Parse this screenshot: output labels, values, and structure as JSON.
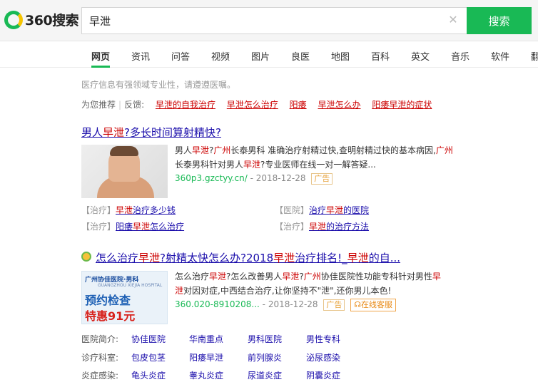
{
  "header": {
    "logo_text": "360搜索",
    "search_value": "早泄",
    "search_button": "搜索"
  },
  "tabs": [
    "网页",
    "资讯",
    "问答",
    "视频",
    "图片",
    "良医",
    "地图",
    "百科",
    "英文",
    "音乐",
    "软件",
    "翻"
  ],
  "notice": "医疗信息有强领域专业性，请遵遵医嘱。",
  "recommend": {
    "label": "为您推荐",
    "sep": "|",
    "feedback": "反馈:",
    "items": [
      "早泄的自我治疗",
      "早泄怎么治疗",
      "阳痿",
      "早泄怎么办",
      "阳痿早泄的症状"
    ]
  },
  "result1": {
    "title_a": "男人",
    "title_b": "早泄",
    "title_c": "?多长时间算射精快?",
    "desc_1a": "男人",
    "desc_1b": "早泄",
    "desc_1c": "?",
    "desc_1d": "广州",
    "desc_1e": "长泰男科 准确治疗射精过快,查明射精过快的基本病因,",
    "desc_2a": "广州",
    "desc_2b": "长泰男科针对男人",
    "desc_2c": "早泄",
    "desc_2d": "?专业医师在线一对一解答疑...",
    "url": "360p3.gzctyy.cn/",
    "date": "- 2018-12-28",
    "ad": "广告",
    "links": [
      {
        "cat": "【治疗】",
        "pre": "",
        "red": "早泄",
        "post": "治疗多少钱"
      },
      {
        "cat": "【医院】",
        "pre": "治疗",
        "red": "早泄",
        "post": "的医院"
      },
      {
        "cat": "【治疗】",
        "pre": "阳痿",
        "red": "早泄",
        "post": "怎么治疗"
      },
      {
        "cat": "【治疗】",
        "pre": "",
        "red": "早泄",
        "post": "的治疗方法"
      }
    ]
  },
  "result2": {
    "title_a": "怎么治疗",
    "title_b": "早泄",
    "title_c": "?射精太快怎么办?2018",
    "title_d": "早泄",
    "title_e": "治疗排名!_",
    "title_f": "早泄",
    "title_g": "的自...",
    "thumb_head": "广州协佳医院·男科",
    "thumb_sub": "GUANGZHOU XIEJIA HOSPITAL",
    "thumb_big": "预约检查",
    "thumb_red": "特惠91元",
    "desc_1a": "怎么治疗",
    "desc_1b": "早泄",
    "desc_1c": "?怎么改善男人",
    "desc_1d": "早泄",
    "desc_1e": "?",
    "desc_1f": "广州",
    "desc_1g": "协佳医院性功能专科针对男性",
    "desc_1h": "早",
    "desc_2a": "泄",
    "desc_2b": "对因对症,中西结合治疗,让你坚持不\"泄\",还你男儿本色!",
    "url": "360.020-8910208...",
    "date": "- 2018-12-28",
    "ad": "广告",
    "service": "在线客服",
    "rows": [
      {
        "label": "医院简介:",
        "items": [
          "协佳医院",
          "华南重点",
          "男科医院",
          "男性专科"
        ]
      },
      {
        "label": "诊疗科室:",
        "items": [
          "包皮包茎",
          "阳痿早泄",
          "前列腺炎",
          "泌尿感染"
        ]
      },
      {
        "label": "炎症感染:",
        "items": [
          "龟头炎症",
          "睾丸炎症",
          "尿道炎症",
          "阴囊炎症"
        ]
      }
    ]
  },
  "colors": {
    "brand_green": "#19b955",
    "link_blue": "#1a0dab",
    "keyword_red": "#cc0000"
  }
}
